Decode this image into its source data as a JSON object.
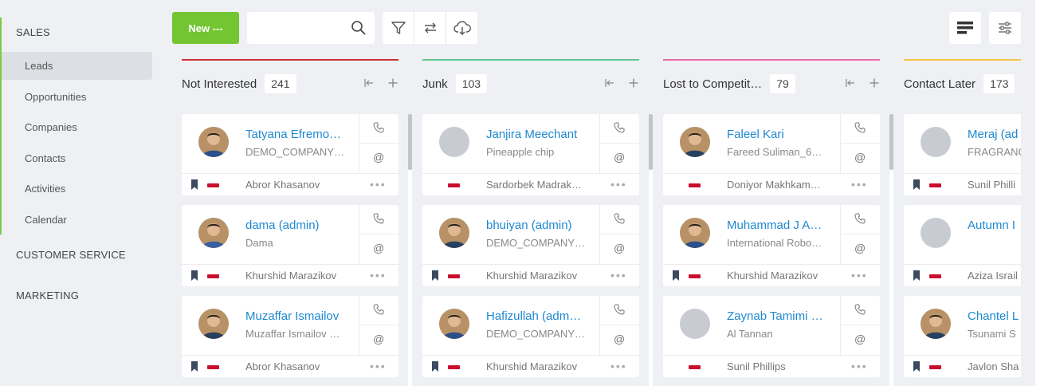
{
  "sidebar": {
    "sections": [
      "SALES",
      "CUSTOMER SERVICE",
      "MARKETING"
    ],
    "items": [
      "Leads",
      "Opportunities",
      "Companies",
      "Contacts",
      "Activities",
      "Calendar"
    ],
    "active_item": "Leads",
    "accent": "#7ac943"
  },
  "toolbar": {
    "new_label": "New ---",
    "search_placeholder": "",
    "icons": [
      "filter-icon",
      "swap-icon",
      "cloud-download-icon",
      "list-view-icon",
      "settings-sliders-icon"
    ]
  },
  "columns": [
    {
      "title": "Not Interested",
      "count": "241",
      "color": "#c9302c",
      "cards": [
        {
          "name": "Tatyana Efremo…",
          "sub": "DEMO_COMPANY…",
          "owner": "Abror Khasanov",
          "avatar": "photo",
          "bookmark": true
        },
        {
          "name": "dama (admin)",
          "sub": "Dama",
          "owner": "Khurshid Marazikov",
          "avatar": "photo",
          "bookmark": true
        },
        {
          "name": "Muzaffar Ismailov",
          "sub": "Muzaffar Ismailov …",
          "owner": "Abror Khasanov",
          "avatar": "photo",
          "bookmark": true
        }
      ]
    },
    {
      "title": "Junk",
      "count": "103",
      "color": "#5cc98f",
      "cards": [
        {
          "name": "Janjira Meechant",
          "sub": "Pineapple chip",
          "owner": "Sardorbek Madrak…",
          "avatar": "none",
          "bookmark": false
        },
        {
          "name": "bhuiyan (admin)",
          "sub": "DEMO_COMPANY…",
          "owner": "Khurshid Marazikov",
          "avatar": "photo",
          "bookmark": true
        },
        {
          "name": "Hafizullah (adm…",
          "sub": "DEMO_COMPANY…",
          "owner": "Khurshid Marazikov",
          "avatar": "photo",
          "bookmark": true
        }
      ]
    },
    {
      "title": "Lost to Competit…",
      "count": "79",
      "color": "#e86aa6",
      "cards": [
        {
          "name": "Faleel Kari",
          "sub": "Fareed Suliman_6…",
          "owner": "Doniyor Makhkam…",
          "avatar": "photo",
          "bookmark": false
        },
        {
          "name": "Muhammad J A…",
          "sub": "International Robo…",
          "owner": "Khurshid Marazikov",
          "avatar": "photo",
          "bookmark": true
        },
        {
          "name": "Zaynab Tamimi …",
          "sub": "Al Tannan",
          "owner": "Sunil Phillips",
          "avatar": "none",
          "bookmark": false
        }
      ]
    },
    {
      "title": "Contact Later",
      "count": "173",
      "color": "#f5c542",
      "cards": [
        {
          "name": "Meraj (ad",
          "sub": "FRAGRANC",
          "owner": "Sunil Philli",
          "avatar": "none",
          "bookmark": true
        },
        {
          "name": "Autumn I",
          "sub": "",
          "owner": "Aziza Israil",
          "avatar": "none",
          "bookmark": true
        },
        {
          "name": "Chantel L",
          "sub": "Tsunami S",
          "owner": "Javlon Sha",
          "avatar": "photo",
          "bookmark": true
        }
      ]
    }
  ]
}
